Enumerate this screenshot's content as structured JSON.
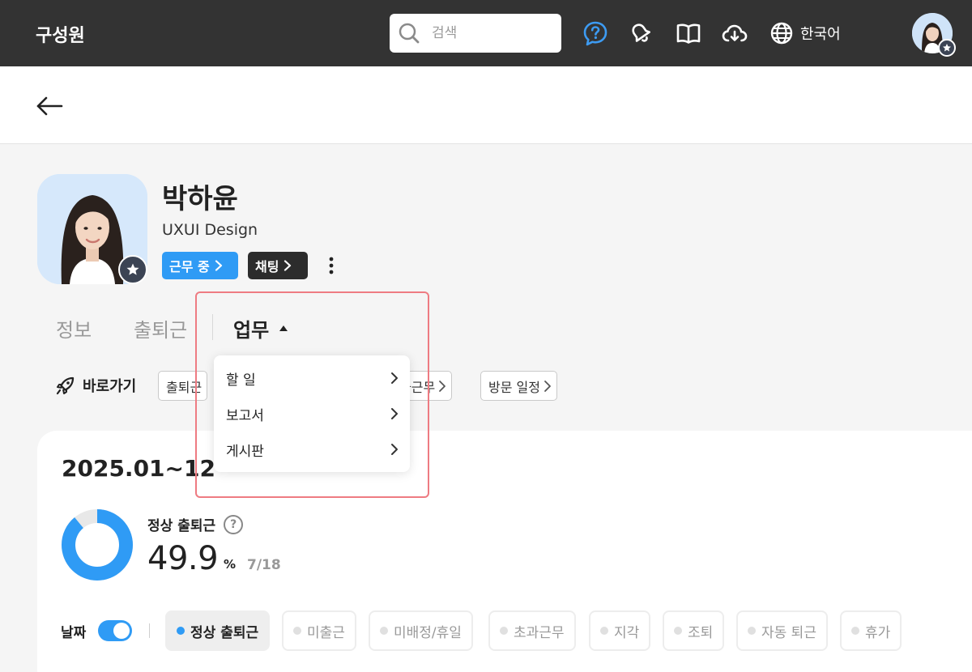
{
  "topbar": {
    "title": "구성원",
    "search_placeholder": "검색",
    "language": "한국어",
    "icons": [
      "help-bubble-icon",
      "bell-icon",
      "book-icon",
      "cloud-download-icon",
      "globe-icon"
    ],
    "help_color": "#3d9bf2"
  },
  "profile": {
    "name": "박하윤",
    "department": "UXUI Design",
    "status_label": "근무 중",
    "chat_label": "채팅"
  },
  "tabs": {
    "info": "정보",
    "attendance": "출퇴근",
    "work": "업무"
  },
  "dropdown": {
    "items": [
      {
        "label": "할 일"
      },
      {
        "label": "보고서"
      },
      {
        "label": "게시판"
      }
    ]
  },
  "shortcuts": {
    "label": "바로가기",
    "chips": [
      "출퇴근",
      "과근무",
      "방문 일정"
    ]
  },
  "summary": {
    "period": "2025.01~12",
    "stat_label": "정상 출퇴근",
    "help": "?",
    "value": "49.9",
    "unit": "%",
    "count": "7/18",
    "progress_fraction": 0.889
  },
  "filters": {
    "date_label": "날짜",
    "items": [
      "정상 출퇴근",
      "미출근",
      "미배정/휴일",
      "초과근무",
      "지각",
      "조퇴",
      "자동 퇴근",
      "휴가"
    ],
    "active_index": 0
  },
  "colors": {
    "accent": "#2f9bf5",
    "topbar": "#333333",
    "highlight": "#ee7b82"
  }
}
